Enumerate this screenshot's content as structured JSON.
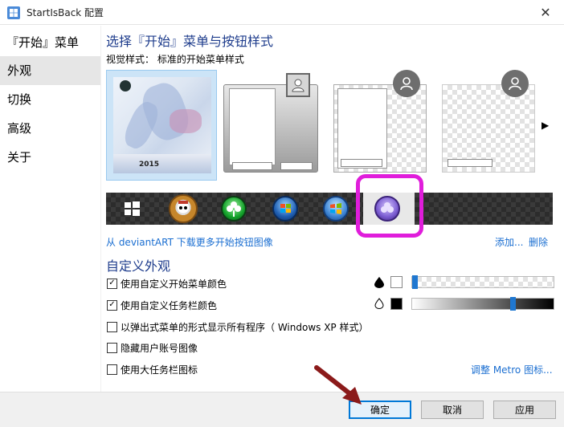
{
  "window": {
    "title": "StartIsBack 配置",
    "close_glyph": "✕"
  },
  "sidebar": {
    "header": "『开始』菜单",
    "items": [
      {
        "label": "外观",
        "active": true
      },
      {
        "label": "切换",
        "active": false
      },
      {
        "label": "高级",
        "active": false
      },
      {
        "label": "关于",
        "active": false
      }
    ]
  },
  "main": {
    "section_title": "选择『开始』菜单与按钮样式",
    "visual_style_label": "视觉样式：",
    "visual_style_value": "标准的开始菜单样式",
    "thumb_year": "2015",
    "orbs": [
      "windows-logo-orb",
      "one-piece-orb",
      "clover-orb",
      "win7-orb",
      "win7-classic-orb",
      "purple-clover-orb"
    ],
    "selected_orb_index": 5,
    "deviantart_link": "从 deviantART 下载更多开始按钮图像",
    "add_link": "添加...",
    "delete_link": "删除",
    "custom_title": "自定义外观",
    "options": [
      {
        "label": "使用自定义开始菜单颜色",
        "checked": true
      },
      {
        "label": "使用自定义任务栏颜色",
        "checked": true
      },
      {
        "label": "以弹出式菜单的形式显示所有程序（ Windows XP 样式）",
        "checked": false
      },
      {
        "label": "隐藏用户账号图像",
        "checked": false
      },
      {
        "label": "使用大任务栏图标",
        "checked": false
      }
    ],
    "menu_color": {
      "swatch": "#ffffff",
      "transparency_level": 0.0
    },
    "taskbar_color": {
      "swatch": "#000000",
      "transparency_level": 0.72
    },
    "metro_link": "调整 Metro 图标...",
    "check_glyph": "✓",
    "scroll_glyph": "▶"
  },
  "footer": {
    "ok": "确定",
    "cancel": "取消",
    "apply": "应用"
  },
  "colors": {
    "accent": "#0078d7",
    "heading": "#1e3c8c",
    "link": "#1a6ed1",
    "highlight": "#e01ddb",
    "arrow": "#8b1a1a"
  }
}
